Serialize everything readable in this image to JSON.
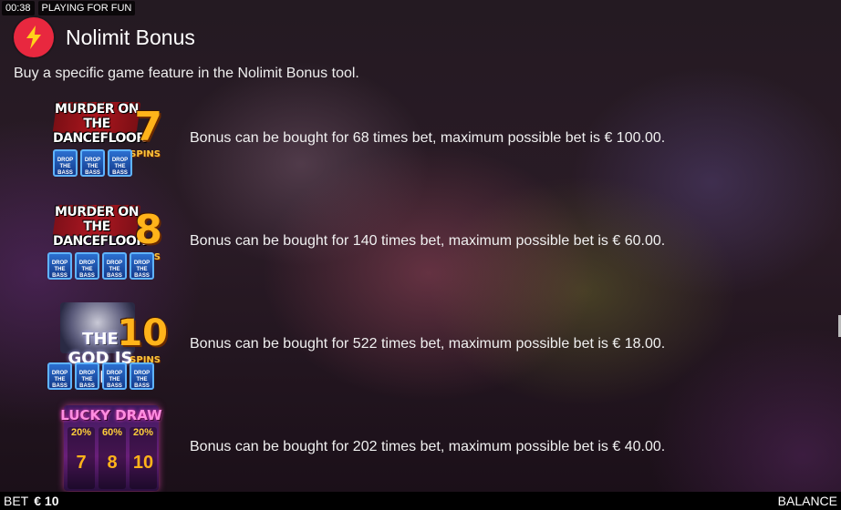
{
  "status": {
    "time": "00:38",
    "mode": "PLAYING FOR FUN"
  },
  "header": {
    "title": "Nolimit Bonus",
    "logo_icon": "lightning-icon"
  },
  "intro": "Buy a specific game feature in the Nolimit Bonus tool.",
  "bonuses": [
    {
      "art_title": "MURDER ON THE DANCEFLOOR",
      "spins": "7",
      "spins_label": "SPINS",
      "tiles": [
        "DROP THE BASS",
        "DROP THE BASS",
        "DROP THE BASS"
      ],
      "description": "Bonus can be bought for 68 times bet, maximum possible bet is € 100.00."
    },
    {
      "art_title": "MURDER ON THE DANCEFLOOR",
      "spins": "8",
      "spins_label": "SPINS",
      "tiles": [
        "DROP THE BASS",
        "DROP THE BASS",
        "DROP THE BASS",
        "DROP THE BASS"
      ],
      "description": "Bonus can be bought for 140 times bet, maximum possible bet is € 60.00."
    },
    {
      "art_title": "THE GOD IS A DJ",
      "spins": "10",
      "spins_label": "SPINS",
      "tiles": [
        "DROP THE BASS",
        "DROP THE BASS",
        "DROP THE BASS",
        "DROP THE BASS"
      ],
      "description": "Bonus can be bought for 522 times bet, maximum possible bet is € 18.00."
    },
    {
      "art_title": "LUCKY DRAW",
      "cells": [
        {
          "pct": "20%",
          "num": "7"
        },
        {
          "pct": "60%",
          "num": "8"
        },
        {
          "pct": "20%",
          "num": "10"
        }
      ],
      "description": "Bonus can be bought for 202 times bet, maximum possible bet is € 40.00."
    }
  ],
  "footer": {
    "bet_label": "BET",
    "bet_value": "€ 10",
    "balance_label": "BALANCE"
  }
}
